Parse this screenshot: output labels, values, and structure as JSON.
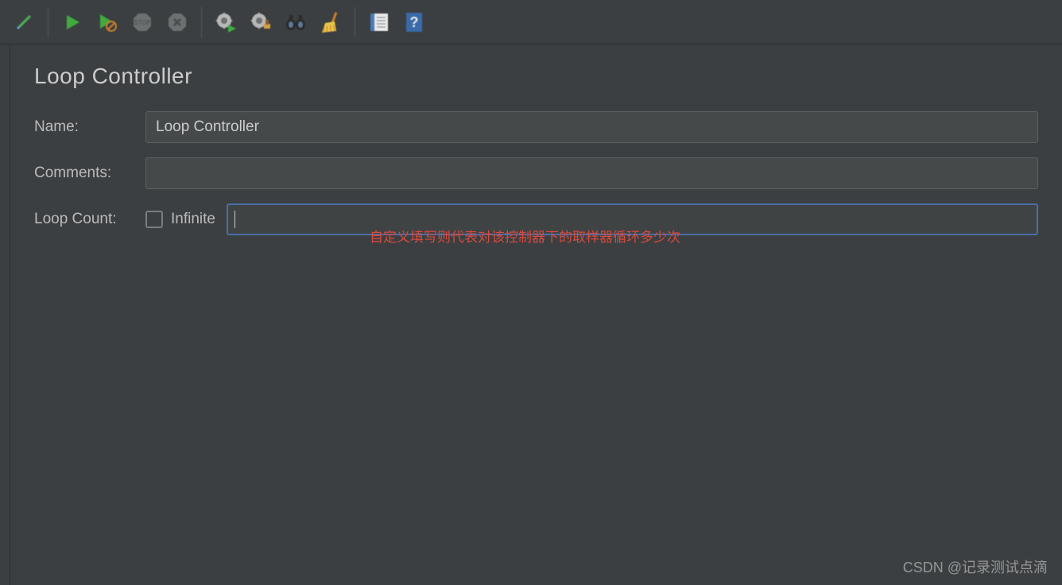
{
  "toolbar": {
    "icons": [
      "edit-icon",
      "run-icon",
      "run-no-pause-icon",
      "stop-icon",
      "shutdown-icon",
      "gear-run-icon",
      "gear-brush-icon",
      "binoculars-icon",
      "broom-icon",
      "notes-icon",
      "help-icon"
    ]
  },
  "panel": {
    "title": "Loop Controller",
    "name_label": "Name:",
    "name_value": "Loop Controller",
    "comments_label": "Comments:",
    "comments_value": "",
    "loop_count_label": "Loop Count:",
    "infinite_label": "Infinite",
    "infinite_checked": false,
    "loop_count_value": ""
  },
  "annotation": "自定义填写则代表对该控制器下的取样器循环多少次",
  "watermark": "CSDN @记录测试点滴"
}
